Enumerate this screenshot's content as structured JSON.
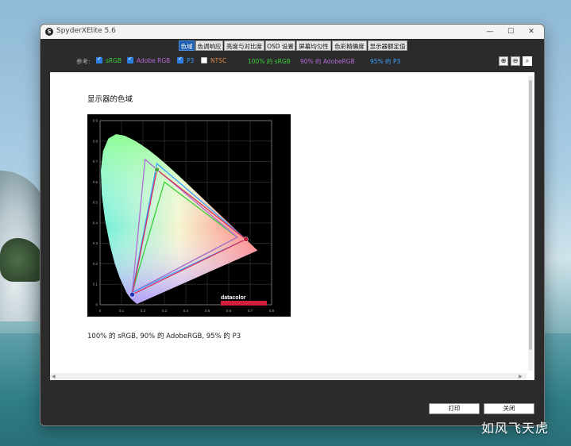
{
  "window": {
    "title": "SpyderXElite 5.6",
    "icon_letter": "S",
    "controls": {
      "minimize": "—",
      "maximize": "☐",
      "close": "✕"
    }
  },
  "tabs": [
    {
      "label": "色域",
      "active": true
    },
    {
      "label": "色调响应",
      "active": false
    },
    {
      "label": "亮度与对比度",
      "active": false
    },
    {
      "label": "OSD 设置",
      "active": false
    },
    {
      "label": "屏幕均匀性",
      "active": false
    },
    {
      "label": "色彩精确度",
      "active": false
    },
    {
      "label": "显示器额定值",
      "active": false
    }
  ],
  "toolbar": {
    "reference_label": "参考:",
    "references": [
      {
        "label": "sRGB",
        "checked": true,
        "color": "#3ccf3c"
      },
      {
        "label": "Adobe RGB",
        "checked": true,
        "color": "#b26ad6"
      },
      {
        "label": "P3",
        "checked": true,
        "color": "#3ca0ff"
      },
      {
        "label": "NTSC",
        "checked": false,
        "color": "#e08a4a"
      }
    ],
    "results": [
      {
        "text": "100% 的 sRGB",
        "color": "#3ccf3c"
      },
      {
        "text": "90% 的 AdobeRGB",
        "color": "#b26ad6"
      },
      {
        "text": "95% 的 P3",
        "color": "#3ca0ff"
      }
    ],
    "zoom_icons": [
      "zoom-in-icon",
      "zoom-out-icon",
      "zoom-fit-icon"
    ]
  },
  "content": {
    "section_title": "显示器的色域",
    "caption": "100% 的 sRGB, 90% 的 AdobeRGB, 95% 的 P3",
    "chart_logo": "datacolor"
  },
  "chart_data": {
    "type": "scatter",
    "xlim": [
      0,
      0.8
    ],
    "ylim": [
      0,
      0.9
    ],
    "x_ticks": [
      "0",
      "0.1",
      "0.2",
      "0.3",
      "0.4",
      "0.5",
      "0.6",
      "0.7",
      "0.8"
    ],
    "y_ticks": [
      "0",
      "0.1",
      "0.2",
      "0.3",
      "0.4",
      "0.5",
      "0.6",
      "0.7",
      "0.8",
      "0.9"
    ],
    "grid": true,
    "series": [
      {
        "points": [
          [
            0.64,
            0.33
          ],
          [
            0.3,
            0.6
          ],
          [
            0.15,
            0.06
          ]
        ],
        "color": "#3ccf3c"
      },
      {
        "points": [
          [
            0.64,
            0.33
          ],
          [
            0.21,
            0.71
          ],
          [
            0.15,
            0.06
          ]
        ],
        "color": "#b26ad6"
      },
      {
        "points": [
          [
            0.68,
            0.32
          ],
          [
            0.265,
            0.69
          ],
          [
            0.15,
            0.06
          ]
        ],
        "color": "#3ca0ff"
      },
      {
        "points": [
          [
            0.68,
            0.32
          ],
          [
            0.265,
            0.66
          ],
          [
            0.15,
            0.05
          ]
        ],
        "color": "#d8305a"
      }
    ],
    "locus": [
      [
        0.1741,
        0.005
      ],
      [
        0.1738,
        0.0049
      ],
      [
        0.1733,
        0.0048
      ],
      [
        0.1726,
        0.0048
      ],
      [
        0.1714,
        0.0051
      ],
      [
        0.1689,
        0.0069
      ],
      [
        0.1644,
        0.0109
      ],
      [
        0.1566,
        0.0177
      ],
      [
        0.144,
        0.0297
      ],
      [
        0.1241,
        0.0578
      ],
      [
        0.0913,
        0.1327
      ],
      [
        0.0687,
        0.2007
      ],
      [
        0.0454,
        0.295
      ],
      [
        0.0235,
        0.4127
      ],
      [
        0.0082,
        0.5384
      ],
      [
        0.0039,
        0.6548
      ],
      [
        0.0139,
        0.7502
      ],
      [
        0.0389,
        0.812
      ],
      [
        0.0743,
        0.8338
      ],
      [
        0.1142,
        0.8262
      ],
      [
        0.1547,
        0.8059
      ],
      [
        0.1929,
        0.7816
      ],
      [
        0.2296,
        0.7543
      ],
      [
        0.2658,
        0.7243
      ],
      [
        0.3016,
        0.6923
      ],
      [
        0.3373,
        0.6589
      ],
      [
        0.3731,
        0.6245
      ],
      [
        0.4087,
        0.5896
      ],
      [
        0.4441,
        0.5547
      ],
      [
        0.4788,
        0.5202
      ],
      [
        0.5125,
        0.4866
      ],
      [
        0.5448,
        0.4544
      ],
      [
        0.5752,
        0.4242
      ],
      [
        0.6029,
        0.3965
      ],
      [
        0.627,
        0.3725
      ],
      [
        0.6482,
        0.3514
      ],
      [
        0.6658,
        0.334
      ],
      [
        0.6801,
        0.3197
      ],
      [
        0.6915,
        0.3083
      ],
      [
        0.7006,
        0.2993
      ],
      [
        0.7079,
        0.292
      ],
      [
        0.714,
        0.2859
      ],
      [
        0.719,
        0.2809
      ],
      [
        0.723,
        0.277
      ],
      [
        0.726,
        0.274
      ],
      [
        0.7347,
        0.2653
      ]
    ]
  },
  "buttons": {
    "print": "打印",
    "close": "关闭"
  },
  "watermark": "如风飞天虎"
}
